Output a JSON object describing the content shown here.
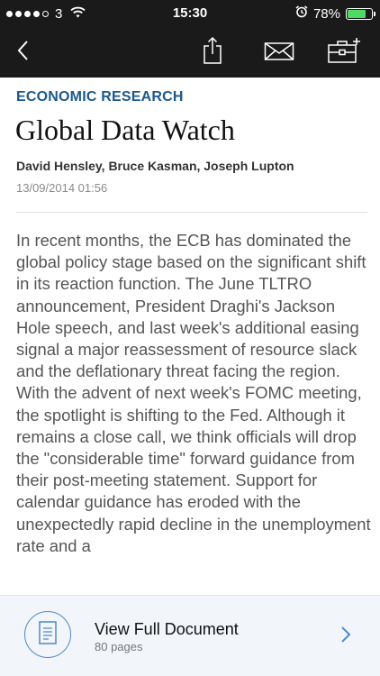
{
  "status": {
    "carrier": "3",
    "time": "15:30",
    "battery": "78%",
    "battery_level": 0.78,
    "signal_dots_filled": 4,
    "colors": {
      "battery_fill": "#4cd964"
    }
  },
  "navbar": {
    "icons": [
      "back-chevron-icon",
      "share-icon",
      "mail-icon",
      "briefcase-add-icon"
    ]
  },
  "article": {
    "section": "ECONOMIC RESEARCH",
    "title": "Global Data Watch",
    "authors": "David Hensley, Bruce Kasman, Joseph Lupton",
    "date": "13/09/2014 01:56",
    "paragraphs": [
      "In recent months, the ECB has dominated the global policy stage based on the significant shift in its reaction function. The June TLTRO announcement, President Draghi's Jackson Hole speech, and last week's additional easing signal a major reassessment of resource slack and the deflationary threat facing the region.",
      "With the advent of next week's FOMC meeting, the spotlight is shifting to the Fed. Although it remains a close call, we think officials will drop the \"considerable time\" forward guidance from their post-meeting statement. Support for calendar guidance has eroded with the unexpectedly rapid decline in the unemployment rate and a"
    ],
    "colors": {
      "section": "#1c5a8c"
    }
  },
  "footer": {
    "title": "View Full Document",
    "subtitle": "80 pages",
    "icons": [
      "document-icon",
      "chevron-right-icon"
    ],
    "colors": {
      "accent": "#4f8ac9"
    }
  }
}
